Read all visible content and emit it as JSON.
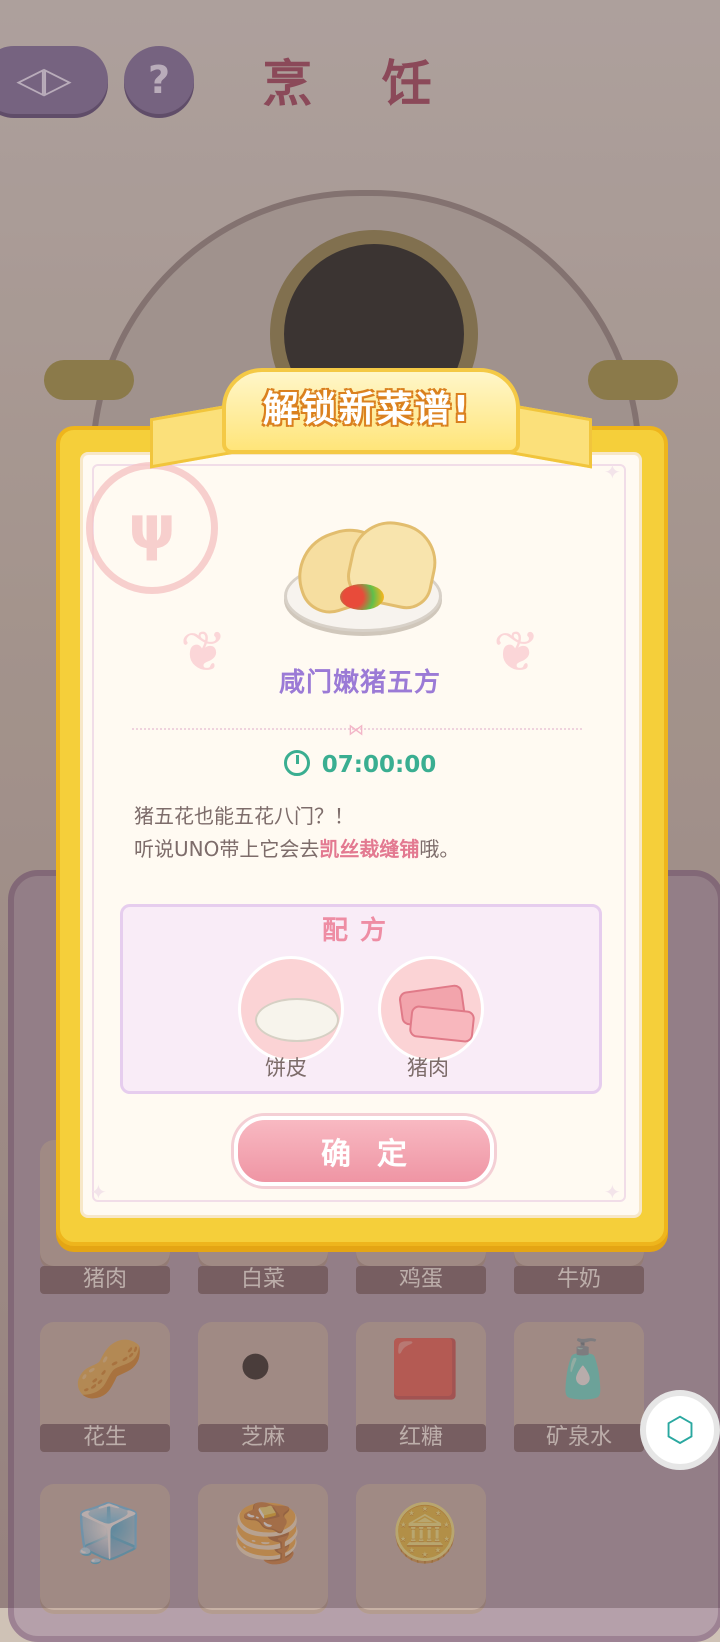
{
  "header": {
    "title": "烹 饪",
    "back_icon": "back-arrow-icon",
    "help_label": "?"
  },
  "background_grid": {
    "row1": [
      "猪肉",
      "白菜",
      "鸡蛋",
      "牛奶"
    ],
    "row2": [
      "花生",
      "芝麻",
      "红糖",
      "矿泉水"
    ]
  },
  "modal": {
    "banner": "解锁新菜谱!",
    "dish_name": "咸门嫩猪五方",
    "cook_time": "07:00:00",
    "description_line1": "猪五花也能五花八门？！",
    "description_line2_pre": "听说UNO带上它会去",
    "description_highlight": "凯丝裁缝铺",
    "description_line2_post": "哦。",
    "recipe": {
      "title": "配方",
      "ingredients": [
        {
          "label": "饼皮",
          "icon": "pancake-icon"
        },
        {
          "label": "猪肉",
          "icon": "pork-icon"
        }
      ]
    },
    "confirm_label": "确定"
  },
  "colors": {
    "frame_yellow": "#f5cf3a",
    "dish_name": "#9b7ad6",
    "timer": "#3aae91",
    "highlight": "#e37a91",
    "button_pink": "#ef95a4"
  }
}
